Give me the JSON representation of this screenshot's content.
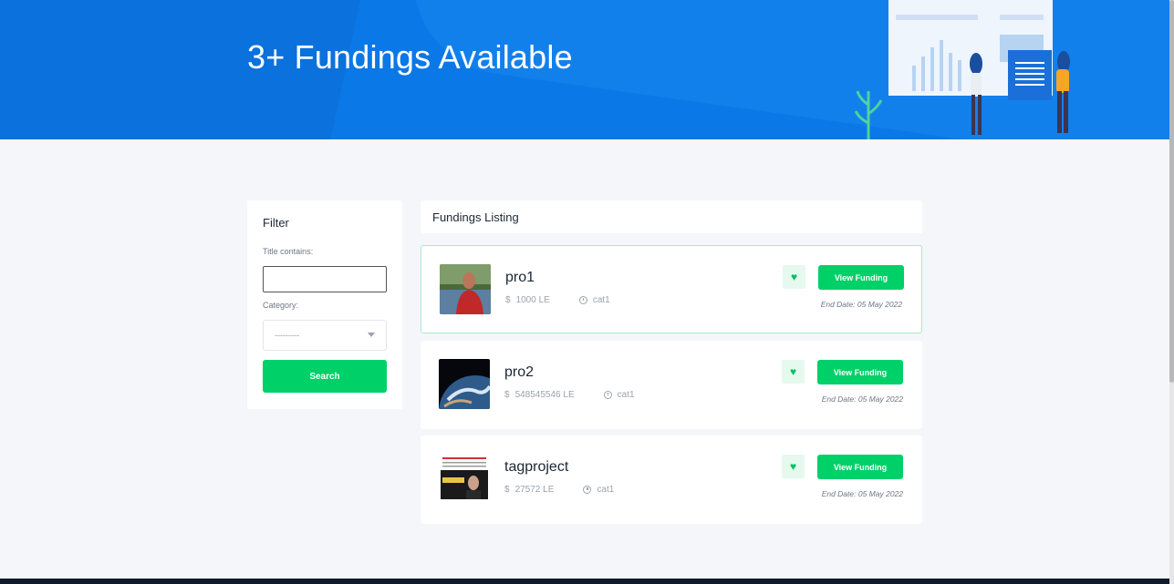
{
  "hero": {
    "title": "3+ Fundings Available"
  },
  "filter": {
    "title": "Filter",
    "title_label": "Title contains:",
    "title_value": "",
    "category_label": "Category:",
    "category_value": "---------",
    "search_label": "Search"
  },
  "listing": {
    "heading": "Fundings Listing",
    "items": [
      {
        "title": "pro1",
        "amount": "1000 LE",
        "category": "cat1",
        "view_label": "View Funding",
        "end_date": "End Date: 05 May 2022",
        "currency_icon": "$",
        "favorite_icon": "heart-icon"
      },
      {
        "title": "pro2",
        "amount": "548545546 LE",
        "category": "cat1",
        "view_label": "View Funding",
        "end_date": "End Date: 05 May 2022",
        "currency_icon": "$",
        "favorite_icon": "heart-icon"
      },
      {
        "title": "tagproject",
        "amount": "27572 LE",
        "category": "cat1",
        "view_label": "View Funding",
        "end_date": "End Date: 05 May 2022",
        "currency_icon": "$",
        "favorite_icon": "heart-icon"
      }
    ]
  },
  "colors": {
    "brand_blue": "#0a78e6",
    "accent_green": "#00d068",
    "page_bg": "#f4f6f9"
  }
}
